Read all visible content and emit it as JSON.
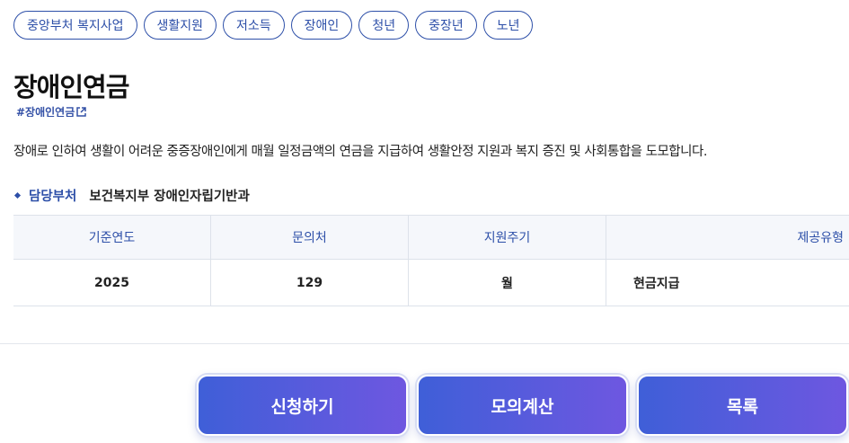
{
  "tags": [
    "중앙부처 복지사업",
    "생활지원",
    "저소득",
    "장애인",
    "청년",
    "중장년",
    "노년"
  ],
  "title": "장애인연금",
  "hashtag": "#장애인연금",
  "description": "장애로 인하여 생활이 어려운 중증장애인에게 매월 일정금액의 연금을 지급하여 생활안정 지원과 복지 증진 및 사회통합을 도모합니다.",
  "department": {
    "label": "담당부처",
    "value": "보건복지부 장애인자립기반과"
  },
  "table": {
    "headers": [
      "기준연도",
      "문의처",
      "지원주기",
      "제공유형"
    ],
    "row": [
      "2025",
      "129",
      "월",
      "현금지급"
    ]
  },
  "buttons": {
    "apply": "신청하기",
    "simulate": "모의계산",
    "list": "목록"
  },
  "colors": {
    "accent": "#2d4fa8",
    "button_gradient_start": "#3f5fd8",
    "button_gradient_end": "#6e57e0"
  }
}
